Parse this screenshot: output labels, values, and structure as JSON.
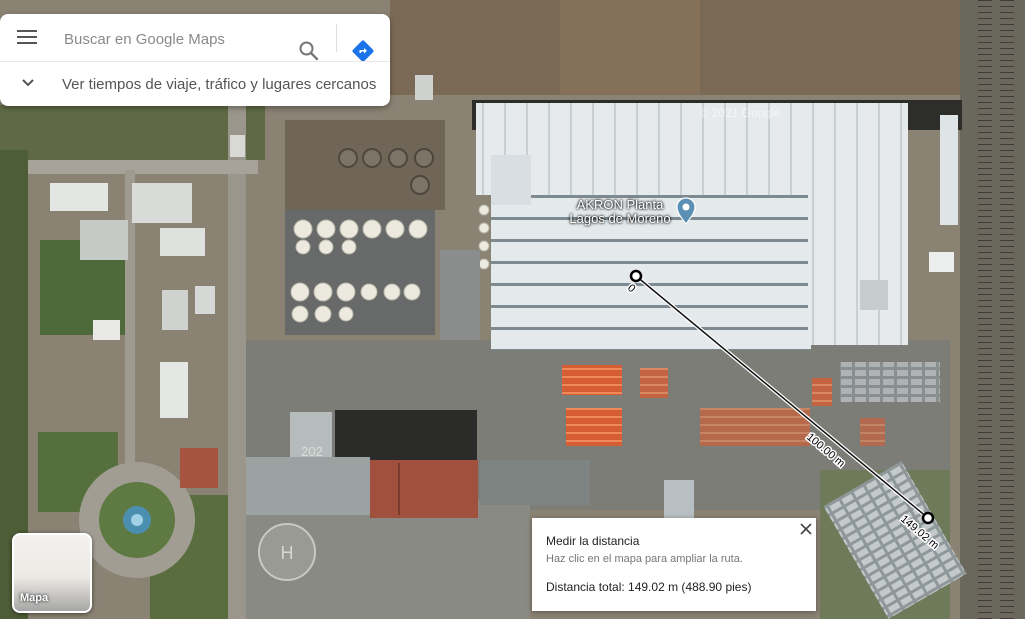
{
  "search": {
    "placeholder": "Buscar en Google Maps"
  },
  "nearby": {
    "label": "Ver tiempos de viaje, tráfico y lugares cercanos"
  },
  "map": {
    "place_line1": "AKRON Planta",
    "place_line2": "Lagos de Moreno",
    "watermark": "© 2021 Google",
    "helipad_mark": "H",
    "building_mark": "202",
    "measure_start_label": "0",
    "measure_mid_label": "100.00 m",
    "measure_end_label": "149.02 m"
  },
  "layer_button": {
    "label": "Mapa"
  },
  "measure_panel": {
    "title": "Medir la distancia",
    "hint": "Haz clic en el mapa para ampliar la ruta.",
    "total": "Distancia total: 149.02 m (488.90 pies)",
    "distance_m": 149.02,
    "distance_ft": 488.9
  },
  "colors": {
    "directions_blue": "#1a73e8",
    "pin_blue": "#5b8fb3",
    "roof_white": "#e8ecee",
    "orange_equipment": "#d9653a"
  }
}
